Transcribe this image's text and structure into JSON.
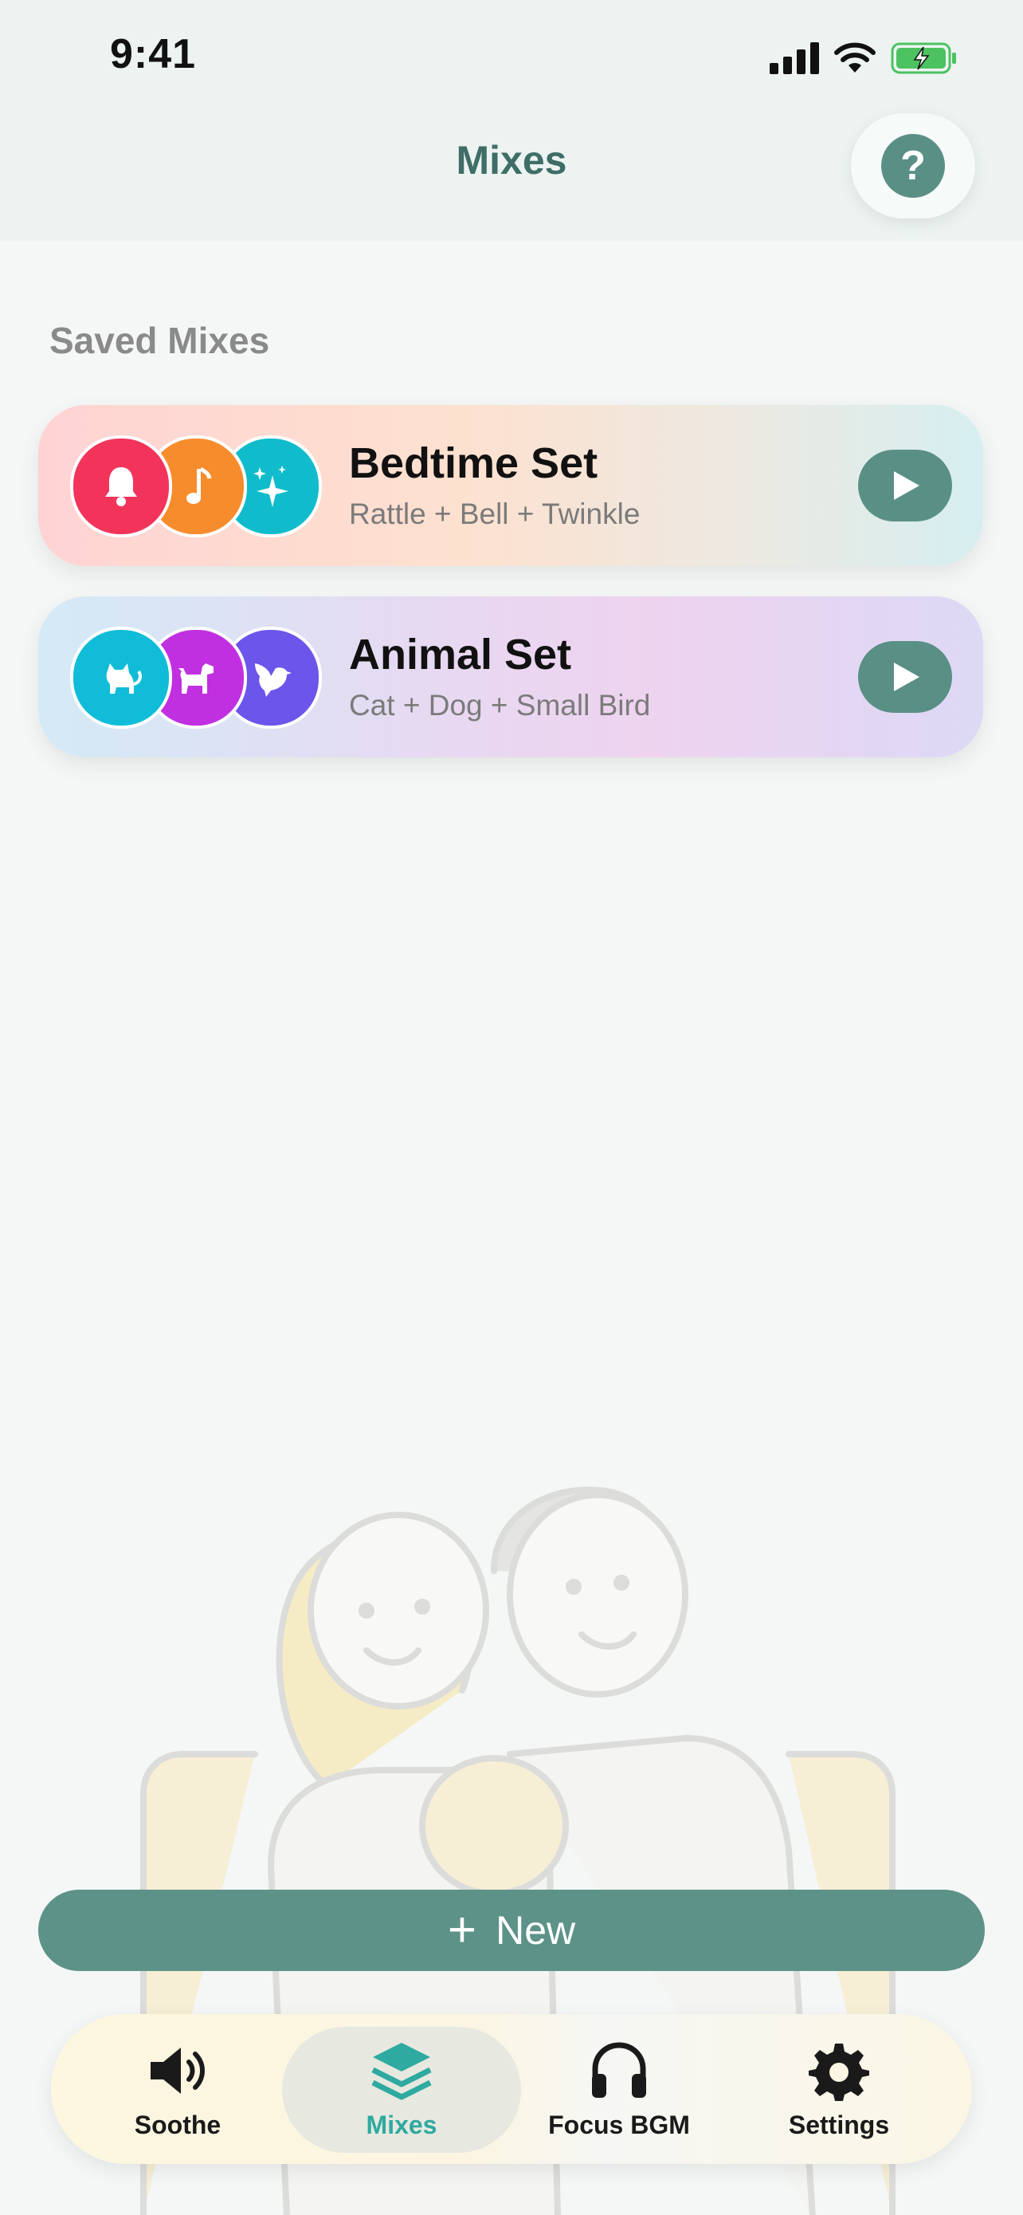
{
  "status_bar": {
    "time": "9:41"
  },
  "header": {
    "title": "Mixes",
    "help_label": "?"
  },
  "section": {
    "title": "Saved Mixes"
  },
  "mixes": [
    {
      "name": "Bedtime Set",
      "description": "Rattle + Bell + Twinkle",
      "icons": [
        {
          "name": "bell-icon",
          "color": "#f2345a"
        },
        {
          "name": "music-note-icon",
          "color": "#f78c2c"
        },
        {
          "name": "sparkle-icon",
          "color": "#10bccc"
        }
      ]
    },
    {
      "name": "Animal Set",
      "description": "Cat + Dog + Small Bird",
      "icons": [
        {
          "name": "cat-icon",
          "color": "#10bcd8"
        },
        {
          "name": "dog-icon",
          "color": "#c02fe0"
        },
        {
          "name": "bird-icon",
          "color": "#6b55ea"
        }
      ]
    }
  ],
  "new_button": {
    "label": "New"
  },
  "tabs": [
    {
      "label": "Soothe",
      "icon": "speaker-icon"
    },
    {
      "label": "Mixes",
      "icon": "layers-icon",
      "active": true
    },
    {
      "label": "Focus BGM",
      "icon": "headphones-icon"
    },
    {
      "label": "Settings",
      "icon": "gear-icon"
    }
  ],
  "colors": {
    "accent": "#5a8f86",
    "active_tab": "#2eaaa0"
  }
}
